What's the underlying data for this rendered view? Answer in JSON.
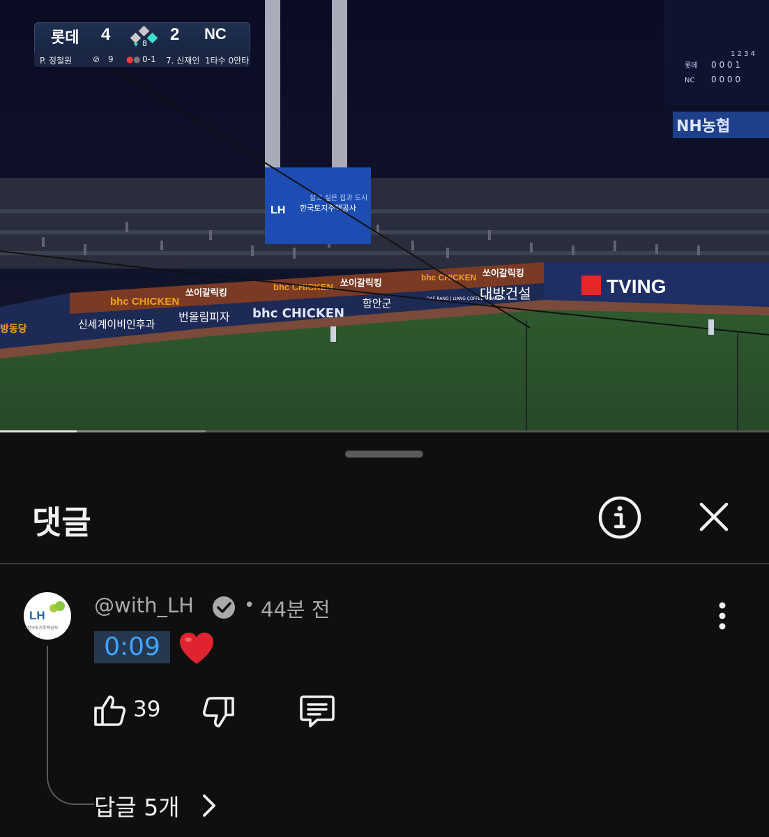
{
  "video": {
    "progress_played": 0.1,
    "progress_buffered": 0.267,
    "scoreboard": {
      "team_left": "롯데",
      "score_left": "4",
      "inning": "8",
      "score_right": "2",
      "team_right": "NC",
      "pitcher": "P. 정철원",
      "pitch_count": "9",
      "count": "0-1",
      "batter": "7. 신재인",
      "batter_stat": "1타수 0안타"
    },
    "ads": {
      "lh_slogan": "살고 싶은 집과 도시",
      "lh_name": "한국토지주택공사",
      "lh_logo": "LH",
      "tving": "TVING",
      "nh": "NH농협",
      "bhc": "bhc CHICKEN",
      "ssoi": "쏘이갈릭킹",
      "daebang": "대방건설",
      "haman": "함안군",
      "shinsegae": "신세계이비인후과",
      "pizza": "번올림피자",
      "daebang_sub": "DAE BANG | LIANG COFFEE & BAKERY",
      "side": "방동당"
    },
    "mini_board": {
      "row1_team": "롯데",
      "row1_scores": "0 0 0 1",
      "row2_team": "NC",
      "row2_scores": "0 0 0 0",
      "innings": "1 2 3 4"
    }
  },
  "sheet": {
    "title": "댓글"
  },
  "comment": {
    "avatar_logo": "LH",
    "avatar_sub": "한국토지주택공사",
    "author": "@with_LH",
    "separator": "•",
    "time_ago": "44분 전",
    "timestamp": "0:09",
    "likes": "39",
    "replies": "답글 5개"
  },
  "colors": {
    "background": "#0f0f0f",
    "timestamp_link": "#3ea6ff",
    "timestamp_bg": "#263850",
    "secondary_text": "#aaaaaa",
    "heart": "#e0242f"
  },
  "icons": {
    "info": "info-circle-icon",
    "close": "close-icon",
    "verified": "verified-check-icon",
    "more": "more-vertical-icon",
    "heart": "red-heart-emoji",
    "like": "thumb-up-icon",
    "dislike": "thumb-down-icon",
    "reply": "comment-reply-icon",
    "chevron": "chevron-right-icon"
  }
}
